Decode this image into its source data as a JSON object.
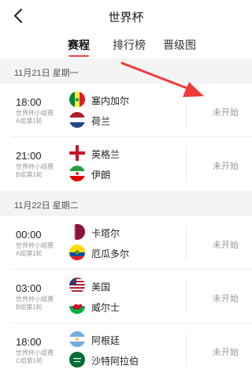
{
  "header": {
    "title": "世界杯",
    "back_icon": "chevron-left-icon"
  },
  "tabs": [
    {
      "label": "赛程",
      "active": true
    },
    {
      "label": "排行榜",
      "active": false
    },
    {
      "label": "晋级图",
      "active": false
    }
  ],
  "days": [
    {
      "date_label": "11月21日 星期一"
    },
    {
      "date_label": "11月22日 星期二"
    }
  ],
  "matches": [
    {
      "time": "18:00",
      "group_line1": "世界杯小组赛",
      "group_line2": "A组第1轮",
      "home": "塞内加尔",
      "away": "荷兰",
      "status": "未开始",
      "home_flag": "senegal-flag-icon",
      "away_flag": "netherlands-flag-icon"
    },
    {
      "time": "21:00",
      "group_line1": "世界杯小组赛",
      "group_line2": "B组第1轮",
      "home": "英格兰",
      "away": "伊朗",
      "status": "未开始",
      "home_flag": "england-flag-icon",
      "away_flag": "iran-flag-icon"
    },
    {
      "time": "00:00",
      "group_line1": "世界杯小组赛",
      "group_line2": "A组第1轮",
      "home": "卡塔尔",
      "away": "厄瓜多尔",
      "status": "未开始",
      "home_flag": "qatar-flag-icon",
      "away_flag": "ecuador-flag-icon"
    },
    {
      "time": "03:00",
      "group_line1": "世界杯小组赛",
      "group_line2": "B组第1轮",
      "home": "美国",
      "away": "威尔士",
      "status": "未开始",
      "home_flag": "usa-flag-icon",
      "away_flag": "wales-flag-icon"
    },
    {
      "time": "18:00",
      "group_line1": "世界杯小组赛",
      "group_line2": "C组第1轮",
      "home": "阿根廷",
      "away": "沙特阿拉伯",
      "status": "未开始",
      "home_flag": "argentina-flag-icon",
      "away_flag": "saudi-arabia-flag-icon"
    }
  ],
  "colors": {
    "accent": "#e94545",
    "annotation_arrow": "#f03a3a",
    "day_header_bg": "#f4f4f4"
  }
}
